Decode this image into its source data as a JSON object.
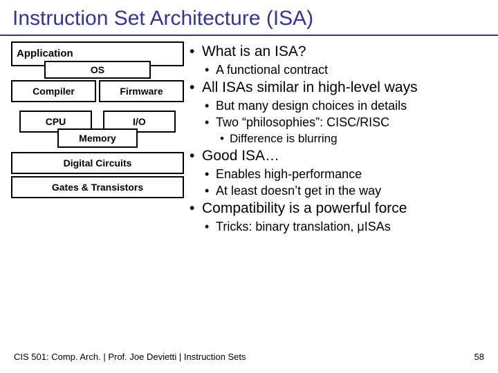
{
  "title": "Instruction Set Architecture (ISA)",
  "diagram": {
    "app": "Application",
    "os": "OS",
    "compiler": "Compiler",
    "firmware": "Firmware",
    "cpu": "CPU",
    "io": "I/O",
    "memory": "Memory",
    "dc": "Digital Circuits",
    "gt": "Gates & Transistors"
  },
  "bullets": {
    "b1": "What is an ISA?",
    "b1a": "A functional contract",
    "b2": "All ISAs similar in high-level ways",
    "b2a": "But many design choices in details",
    "b2b": "Two “philosophies”: CISC/RISC",
    "b2b1": "Difference is blurring",
    "b3": "Good ISA…",
    "b3a": "Enables high-performance",
    "b3b": "At least doesn’t get in the way",
    "b4": "Compatibility is a powerful force",
    "b4a": "Tricks: binary translation, μISAs"
  },
  "footer": {
    "left": "CIS 501: Comp. Arch.  |  Prof. Joe Devietti  |  Instruction Sets",
    "right": "58"
  }
}
